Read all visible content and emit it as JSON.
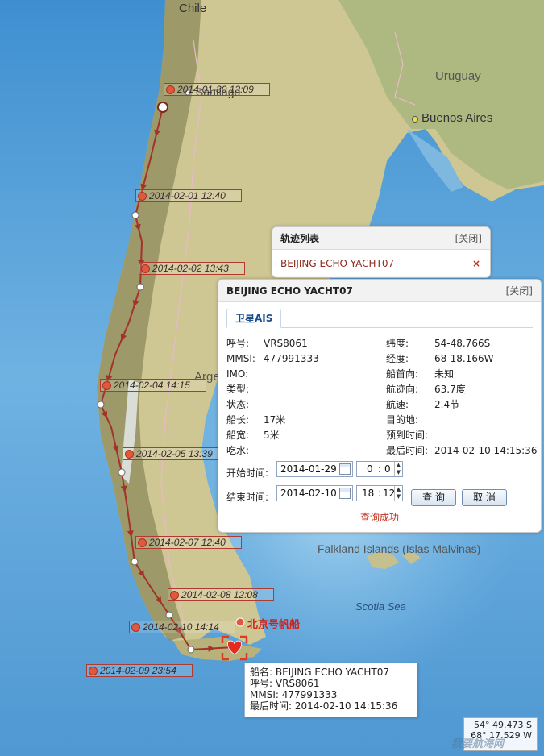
{
  "map": {
    "places": {
      "chile": "Chile",
      "santiago": "Santiago",
      "uruguay": "Uruguay",
      "buenos_aires": "Buenos Aires",
      "argentina_partial": "Arge",
      "falkland": "Falkland Islands (Islas Malvinas)",
      "scotia_sea": "Scotia Sea"
    },
    "track_labels": [
      "2014-01-30 13:09",
      "2014-02-01 12:40",
      "2014-02-02 13:43",
      "2014-02-04 14:15",
      "2014-02-05 13:39",
      "2014-02-07 12:40",
      "2014-02-08 12:08",
      "2014-02-10 14:14",
      "2014-02-09 23:54"
    ],
    "ship_label": "北京号帆船",
    "coordinates": {
      "lat": "54° 49.473 S",
      "lon": "68° 17.529 W"
    },
    "watermark": "我要航海网"
  },
  "track_list": {
    "title": "轨迹列表",
    "close": "[关闭]",
    "items": [
      {
        "name": "BEIJING ECHO YACHT07",
        "remove": "×"
      }
    ]
  },
  "vessel_panel": {
    "title": "BEIJING ECHO YACHT07",
    "close": "[关闭]",
    "tab": "卫星AIS",
    "left": [
      {
        "k": "呼号:",
        "v": "VRS8061"
      },
      {
        "k": "MMSI:",
        "v": "477991333"
      },
      {
        "k": "IMO:",
        "v": ""
      },
      {
        "k": "类型:",
        "v": ""
      },
      {
        "k": "状态:",
        "v": ""
      },
      {
        "k": "船长:",
        "v": "17米"
      },
      {
        "k": "船宽:",
        "v": "5米"
      },
      {
        "k": "吃水:",
        "v": ""
      }
    ],
    "right": [
      {
        "k": "纬度:",
        "v": "54-48.766S"
      },
      {
        "k": "经度:",
        "v": "68-18.166W"
      },
      {
        "k": "船首向:",
        "v": "未知"
      },
      {
        "k": "航迹向:",
        "v": "63.7度"
      },
      {
        "k": "航速:",
        "v": "2.4节"
      },
      {
        "k": "目的地:",
        "v": ""
      },
      {
        "k": "预到时间:",
        "v": ""
      },
      {
        "k": "最后时间:",
        "v": "2014-02-10 14:15:36"
      }
    ],
    "start_label": "开始时间:",
    "start_date": "2014-01-29",
    "start_hour": "0",
    "start_min": "0",
    "end_label": "结束时间:",
    "end_date": "2014-02-10",
    "end_hour": "18",
    "end_min": "12",
    "query_button": "查 询",
    "cancel_button": "取 消",
    "status": "查询成功"
  },
  "tooltip": {
    "lines": [
      "船名:  BEIJING ECHO YACHT07",
      "呼号:  VRS8061",
      "MMSI:  477991333",
      "最后时间:   2014-02-10 14:15:36"
    ]
  },
  "colors": {
    "track": "#a4312a",
    "label_border": "#b03a2e",
    "ocean": "#5f9fd4",
    "land": "#c9c08a"
  }
}
